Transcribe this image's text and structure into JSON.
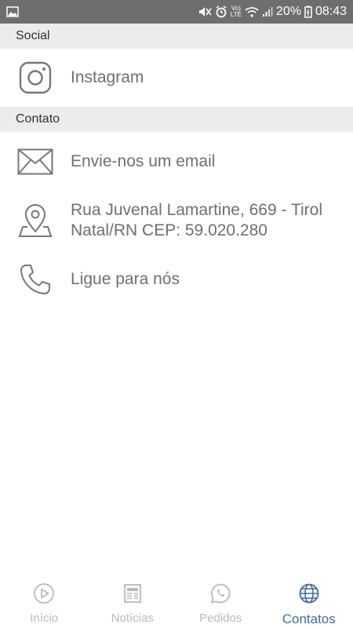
{
  "status_bar": {
    "battery": "20%",
    "time": "08:43",
    "volte_top": "Vo)",
    "volte_bottom": "LTE"
  },
  "sections": {
    "social": {
      "title": "Social",
      "items": [
        {
          "label": "Instagram",
          "icon": "instagram-icon"
        }
      ]
    },
    "contato": {
      "title": "Contato",
      "items": [
        {
          "label": "Envie-nos um email",
          "icon": "mail-icon"
        },
        {
          "label_line1": "Rua Juvenal Lamartine, 669 - Tirol",
          "label_line2": "Natal/RN CEP: 59.020.280",
          "icon": "location-pin-icon"
        },
        {
          "label": "Ligue para nós",
          "icon": "phone-icon"
        }
      ]
    }
  },
  "bottom_nav": {
    "items": [
      {
        "label": "Início",
        "icon": "play-circle-icon"
      },
      {
        "label": "Notícias",
        "icon": "newspaper-icon"
      },
      {
        "label": "Pedidos",
        "icon": "whatsapp-icon"
      },
      {
        "label": "Contatos",
        "icon": "globe-icon"
      }
    ],
    "active_index": 3
  },
  "colors": {
    "status_bar": "#6e6e6e",
    "section_header_bg": "#ececec",
    "label_text": "#6f6f6f",
    "nav_inactive": "#b9b9b9",
    "nav_active": "#3f6aa8"
  }
}
